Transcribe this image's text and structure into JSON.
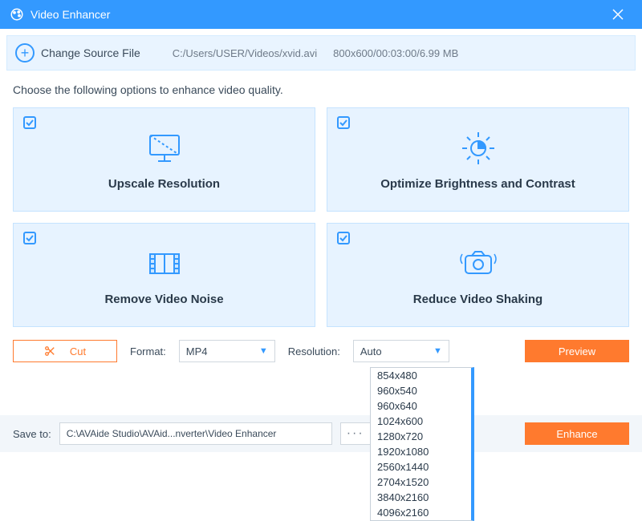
{
  "titlebar": {
    "title": "Video Enhancer"
  },
  "filebar": {
    "change_label": "Change Source File",
    "path": "C:/Users/USER/Videos/xvid.avi",
    "info": "800x600/00:03:00/6.99 MB"
  },
  "instruction": "Choose the following options to enhance video quality.",
  "cards": {
    "upscale": "Upscale Resolution",
    "brightness": "Optimize Brightness and Contrast",
    "noise": "Remove Video Noise",
    "shake": "Reduce Video Shaking"
  },
  "controls": {
    "cut": "Cut",
    "format_label": "Format:",
    "format_value": "MP4",
    "resolution_label": "Resolution:",
    "resolution_value": "Auto",
    "preview": "Preview"
  },
  "resolution_options": [
    "854x480",
    "960x540",
    "960x640",
    "1024x600",
    "1280x720",
    "1920x1080",
    "2560x1440",
    "2704x1520",
    "3840x2160",
    "4096x2160"
  ],
  "savebar": {
    "label": "Save to:",
    "path": "C:\\AVAide Studio\\AVAid...nverter\\Video Enhancer",
    "enhance": "Enhance"
  }
}
